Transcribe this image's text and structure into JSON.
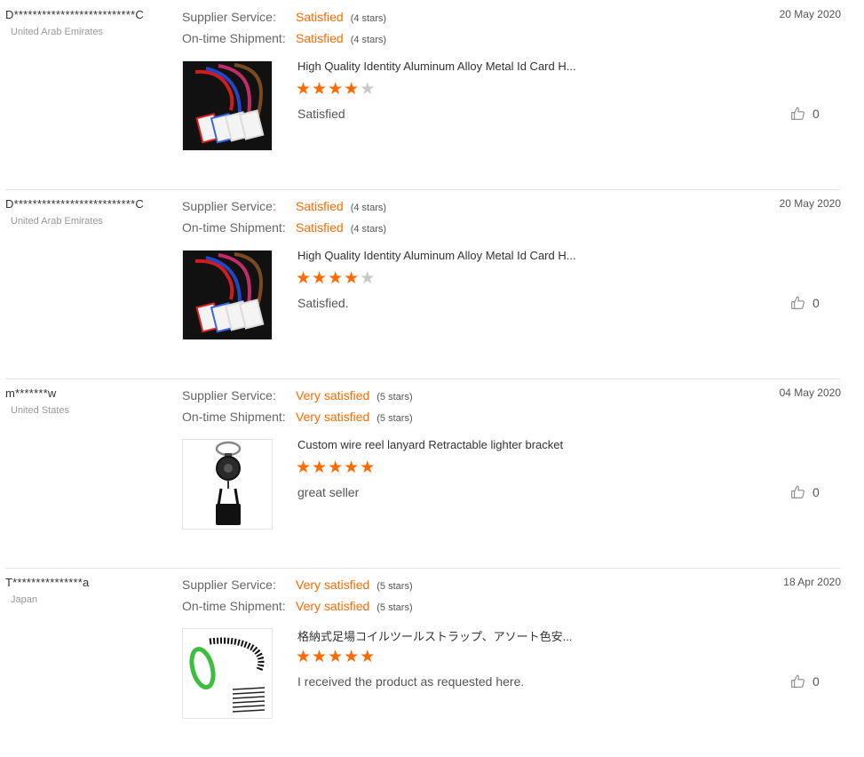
{
  "reviews": [
    {
      "buyer": "D**************************C",
      "country": "United Arab Emirates",
      "supplier_label": "Supplier Service:",
      "supplier_value": "Satisfied",
      "supplier_stars": "(4 stars)",
      "shipment_label": "On-time Shipment:",
      "shipment_value": "Satisfied",
      "shipment_stars": "(4 stars)",
      "date": "20 May 2020",
      "product_title": "High Quality Identity Aluminum Alloy Metal Id Card H...",
      "rating": 4,
      "comment": "Satisfied",
      "helpful_count": "0",
      "product_icon": "lanyard-badge-holder"
    },
    {
      "buyer": "D**************************C",
      "country": "United Arab Emirates",
      "supplier_label": "Supplier Service:",
      "supplier_value": "Satisfied",
      "supplier_stars": "(4 stars)",
      "shipment_label": "On-time Shipment:",
      "shipment_value": "Satisfied",
      "shipment_stars": "(4 stars)",
      "date": "20 May 2020",
      "product_title": "High Quality Identity Aluminum Alloy Metal Id Card H...",
      "rating": 4,
      "comment": "Satisfied.",
      "helpful_count": "0",
      "product_icon": "lanyard-badge-holder"
    },
    {
      "buyer": "m*******w",
      "country": "United States",
      "supplier_label": "Supplier Service:",
      "supplier_value": "Very satisfied",
      "supplier_stars": "(5 stars)",
      "shipment_label": "On-time Shipment:",
      "shipment_value": "Very satisfied",
      "shipment_stars": "(5 stars)",
      "date": "04 May 2020",
      "product_title": "Custom wire reel lanyard Retractable lighter bracket",
      "rating": 5,
      "comment": "great seller",
      "helpful_count": "0",
      "product_icon": "retractable-reel-lighter-holder"
    },
    {
      "buyer": "T***************a",
      "country": "Japan",
      "supplier_label": "Supplier Service:",
      "supplier_value": "Very satisfied",
      "supplier_stars": "(5 stars)",
      "shipment_label": "On-time Shipment:",
      "shipment_value": "Very satisfied",
      "shipment_stars": "(5 stars)",
      "date": "18 Apr 2020",
      "product_title": "格納式足場コイルツールストラップ、アソート色安...",
      "rating": 5,
      "comment": "I received the product as requested here.",
      "helpful_count": "0",
      "product_icon": "coil-tool-strap"
    }
  ],
  "colors": {
    "accent": "#ff6a00",
    "star_off": "#c8c8c8",
    "divider": "#e3e3e3"
  },
  "icons": {
    "helpful": "thumbs-up-icon",
    "star": "star-icon"
  }
}
